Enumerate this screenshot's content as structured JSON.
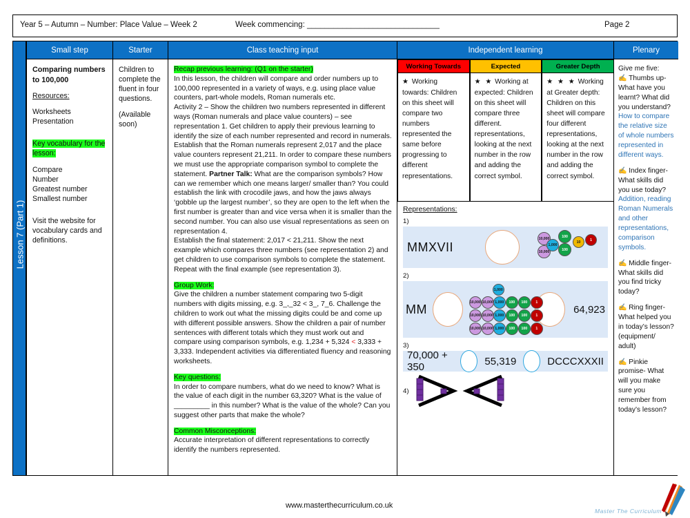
{
  "header": {
    "left": "Year 5 – Autumn – Number: Place Value – Week 2",
    "week_commencing": "Week commencing: ______________________________",
    "page": "Page 2"
  },
  "lesson_tab": "Lesson 7 (Part 1)",
  "columns": {
    "small_step": "Small step",
    "starter": "Starter",
    "class_teaching_input": "Class teaching input",
    "independent_learning": "Independent learning",
    "plenary": "Plenary"
  },
  "small_step": {
    "title": "Comparing numbers to 100,000",
    "resources_label": "Resources:",
    "resources": [
      "Worksheets",
      "Presentation"
    ],
    "key_vocab_label": "Key vocabulary for the lesson:",
    "vocab": [
      "Compare",
      "Number",
      "Greatest number",
      "Smallest number"
    ],
    "website_note": "Visit the website for vocabulary cards and definitions."
  },
  "starter": {
    "line1": "Children to complete the fluent in four questions.",
    "line2": "(Available soon)"
  },
  "teaching": {
    "recap_label": "Recap previous learning: (Q1 on the starter)",
    "recap_body": "In this lesson, the children will compare and order numbers up to 100,000 represented in a variety of ways, e.g. using place value counters, part-whole models, Roman numerals etc.",
    "activity_part1": "Activity 2 – Show the children two numbers represented in different ways (Roman numerals and place value counters) – see representation 1. Get children to apply their previous learning to identify the size of each number represented and record in numerals. Establish that the Roman numerals represent 2,017 and the place value counters represent 21,211. In order to compare these numbers we must use the appropriate comparison symbol to complete the statement. ",
    "partner_talk_label": "Partner Talk:",
    "activity_part2": " What are the comparison symbols? How can we remember which one means larger/ smaller than? You could establish the link with crocodile jaws, and how the jaws always ‘gobble up the largest number’, so they are open to the left when the first number is greater than and vice versa when it is smaller than the second number. You can also use visual representations  as seen on representation 4.",
    "activity_part3": " Establish the final statement: 2,017 < 21,211.  Show the next example which compares  three numbers (see representation 2) and get children to use comparison symbols to complete the statement. Repeat with the final example (see representation 3).",
    "group_work_label": "Group Work:",
    "group_work_a": "Give the children a number statement comparing two 5-digit numbers with digits missing, e.g. 3_,_32 < 3_, 7_6. Challenge the children to work out what the missing digits could be and come up with different possible answers. Show the children a pair of number sentences with different totals which they must work out and compare using comparison symbols, e.g. 1,234 + 5,324 ",
    "group_work_symbol": "<",
    "group_work_b": " 3,333 + 3,333. Independent activities via differentiated fluency and reasoning worksheets.",
    "key_questions_label": "Key questions:",
    "key_questions_body": "In order to compare numbers, what do we need to know? What is the value of each digit in the number 63,320? What is the value of _________ in this number? What is the value of the whole? Can you suggest other parts that make the whole?",
    "misconceptions_label": "Common Misconceptions:",
    "misconceptions_body": "Accurate interpretation of different representations to correctly identify the numbers represented."
  },
  "independent": {
    "bands": [
      {
        "name": "Working Towards",
        "color": "#ff0000",
        "stars": "★",
        "heading": "Working towards:",
        "body": "Children on this sheet will compare two numbers represented the same before progressing to different representations."
      },
      {
        "name": "Expected",
        "color": "#ffc000",
        "stars": "★ ★",
        "heading": "Working at expected:",
        "body": "Children on this sheet will compare three different. representations, looking at the next number in the row and adding the correct symbol."
      },
      {
        "name": "Greater Depth",
        "color": "#00b050",
        "stars": "★ ★ ★",
        "heading": "Working at Greater depth:",
        "body": "Children on this sheet will compare four different representations, looking at the next number in the row and adding the correct symbol."
      }
    ],
    "representations_label": "Representations:",
    "rep1": {
      "number": "1)",
      "roman": "MMXVII",
      "counters": [
        "10,000",
        "10,000",
        "1,000",
        "100",
        "100",
        "10",
        "1"
      ]
    },
    "rep2": {
      "number": "2)",
      "roman": "MM",
      "value": "64,923",
      "counters_rows": [
        [
          "1,000"
        ],
        [
          "10,000",
          "10,000",
          "1,000",
          "100",
          "100",
          "1"
        ],
        [
          "10,000",
          "10,000",
          "1,000",
          "100",
          "100",
          "1"
        ],
        [
          "10,000",
          "10,000",
          "1,000",
          "100",
          "100",
          "1"
        ]
      ]
    },
    "rep3": {
      "number": "3)",
      "expr": "70,000 + 350",
      "mid": "55,319",
      "roman": "DCCCXXXII"
    },
    "rep4": {
      "number": "4)",
      "symbols": [
        "greater-than-cubes",
        "less-than-cubes"
      ]
    }
  },
  "plenary": {
    "intro": "Give me five:",
    "items": [
      {
        "icon": "hand-icon",
        "prompt": "Thumbs up- What have you learnt? What did you understand?",
        "answer": "How to compare the relative size of whole numbers represented in different ways."
      },
      {
        "icon": "hand-icon",
        "prompt": "Index finger- What skills did you use today?",
        "answer": "Addition, reading Roman Numerals and other representations, comparison symbols."
      },
      {
        "icon": "hand-icon",
        "prompt": "Middle finger- What skills did you find tricky today?",
        "answer": ""
      },
      {
        "icon": "hand-icon",
        "prompt": "Ring finger- What helped you in today’s lesson? (equipment/ adult)",
        "answer": ""
      },
      {
        "icon": "hand-icon",
        "prompt": "Pinkie promise- What will you make sure you remember from today’s lesson?",
        "answer": ""
      }
    ]
  },
  "footer": {
    "url": "www.masterthecurriculum.co.uk",
    "logo_text": "Master  The  Curriculum"
  },
  "colors": {
    "header_blue": "#0d71c5",
    "highlight_green": "#1aff1a",
    "rep_background": "#dce8f7",
    "answer_blue": "#2e74b5"
  }
}
